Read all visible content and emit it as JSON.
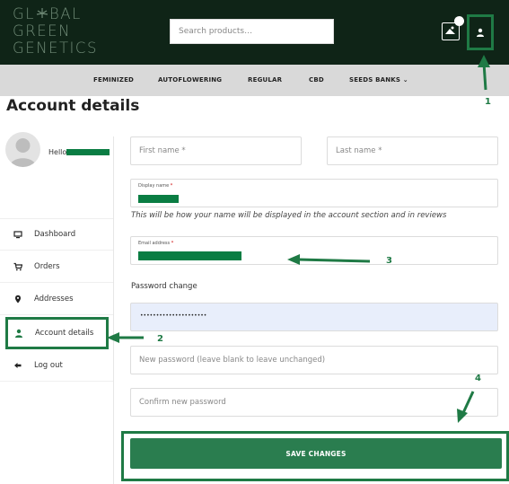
{
  "header": {
    "logo_lines": [
      "GL",
      "BAL",
      "GREEN",
      "GENETICS"
    ],
    "search_placeholder": "Search products…"
  },
  "nav": {
    "items": [
      "FEMINIZED",
      "AUTOFLOWERING",
      "REGULAR",
      "CBD",
      "SEEDS BANKS ⌄"
    ]
  },
  "page_title": "Account details",
  "sidebar": {
    "hello": "Hello",
    "items": [
      {
        "label": "Dashboard",
        "icon": "dashboard-icon"
      },
      {
        "label": "Orders",
        "icon": "cart-icon"
      },
      {
        "label": "Addresses",
        "icon": "map-marker-icon"
      },
      {
        "label": "Account details",
        "icon": "user-icon"
      },
      {
        "label": "Log out",
        "icon": "logout-icon"
      }
    ]
  },
  "form": {
    "first_name_placeholder": "First name *",
    "last_name_placeholder": "Last name *",
    "display_name_label": "Display name",
    "display_name_hint": "This will be how your name will be displayed in the account section and in reviews",
    "email_label": "Email address",
    "required_mark": "*",
    "password_section": "Password change",
    "current_password_dots": "•••••••••••••••••••••",
    "new_password_placeholder": "New password (leave blank to leave unchanged)",
    "confirm_password_placeholder": "Confirm new password",
    "save_label": "SAVE CHANGES"
  },
  "annotations": [
    "1",
    "2",
    "3",
    "4"
  ],
  "colors": {
    "header_bg": "#0f2417",
    "accent_green": "#2a7d4f",
    "annotation_green": "#1f7a45",
    "nav_bg": "#d9d9d9"
  }
}
